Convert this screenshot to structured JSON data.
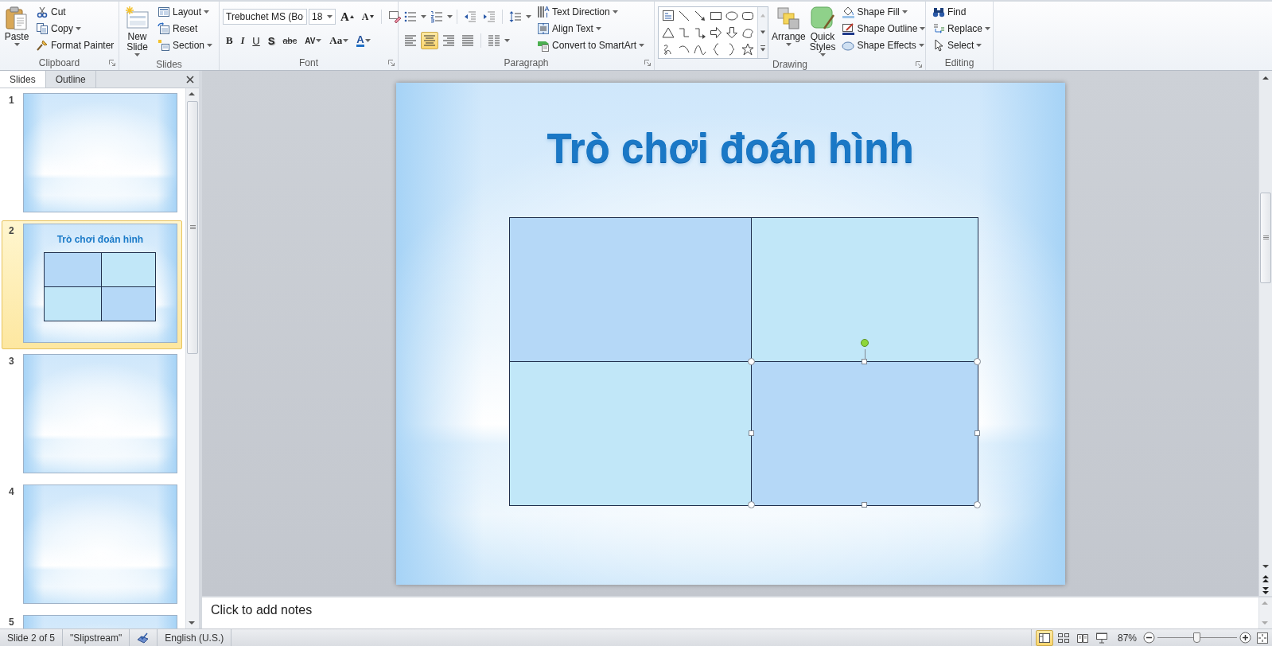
{
  "ribbon": [
    {
      "kind": "clipboard",
      "label": "Clipboard",
      "launcher": true,
      "large": [
        {
          "label": "Paste",
          "dropdown": true
        }
      ],
      "commands": [
        {
          "label": "Cut",
          "dropdown": false
        },
        {
          "label": "Copy",
          "dropdown": true
        },
        {
          "label": "Format Painter",
          "dropdown": false
        }
      ]
    },
    {
      "kind": "slides",
      "label": "Slides",
      "launcher": false,
      "large": [
        {
          "label": "New Slide",
          "dropdown": true
        }
      ],
      "commands": [
        {
          "label": "Layout",
          "dropdown": true
        },
        {
          "label": "Reset",
          "dropdown": false
        },
        {
          "label": "Section",
          "dropdown": true
        }
      ]
    },
    {
      "kind": "font",
      "label": "Font",
      "launcher": true,
      "font_name": "Trebuchet MS (Bo",
      "font_size": "18",
      "grow": "A",
      "shrink": "A",
      "formats": [
        {
          "label": "B",
          "dropdown": false
        },
        {
          "label": "I",
          "dropdown": false
        },
        {
          "label": "U",
          "dropdown": false
        },
        {
          "label": "S",
          "dropdown": false
        },
        {
          "label": "abc",
          "dropdown": false
        },
        {
          "label": "AV",
          "dropdown": true
        },
        {
          "label": "Aa",
          "dropdown": true
        },
        {
          "label": "A",
          "dropdown": true
        }
      ]
    },
    {
      "kind": "paragraph",
      "label": "Paragraph",
      "launcher": true,
      "alignments": [
        {
          "selected": false
        },
        {
          "selected": true
        },
        {
          "selected": false
        },
        {
          "selected": false
        }
      ],
      "commands": [
        {
          "label": "Text Direction",
          "dropdown": true
        },
        {
          "label": "Align Text",
          "dropdown": true
        },
        {
          "label": "Convert to SmartArt",
          "dropdown": true
        }
      ]
    },
    {
      "kind": "drawing",
      "label": "Drawing",
      "launcher": true,
      "large": [
        {
          "label": "Arrange",
          "dropdown": true
        },
        {
          "label": "Quick Styles",
          "dropdown": true
        }
      ],
      "commands": [
        {
          "label": "Shape Fill",
          "dropdown": true
        },
        {
          "label": "Shape Outline",
          "dropdown": true
        },
        {
          "label": "Shape Effects",
          "dropdown": true
        }
      ]
    },
    {
      "kind": "editing",
      "label": "Editing",
      "launcher": false,
      "commands": [
        {
          "label": "Find",
          "dropdown": false
        },
        {
          "label": "Replace",
          "dropdown": true
        },
        {
          "label": "Select",
          "dropdown": true
        }
      ]
    }
  ],
  "panel_tabs": [
    {
      "label": "Slides",
      "selected": true
    },
    {
      "label": "Outline",
      "selected": false
    }
  ],
  "thumbnails": [
    {
      "number": "1",
      "selected": false
    },
    {
      "number": "2",
      "selected": true,
      "title": "Trò chơi đoán hình",
      "shapes": [
        {
          "color": "#b5d8f7"
        },
        {
          "color": "#c1e7f8"
        },
        {
          "color": "#c1e7f8"
        },
        {
          "color": "#b5d8f7"
        }
      ]
    },
    {
      "number": "3",
      "selected": false
    },
    {
      "number": "4",
      "selected": false
    },
    {
      "number": "5",
      "selected": false
    }
  ],
  "slide": {
    "title": "Trò chơi đoán hình",
    "shapes": [
      {
        "color": "#b5d8f7",
        "selected": false
      },
      {
        "color": "#c1e7f8",
        "selected": false
      },
      {
        "color": "#c1e7f8",
        "selected": false
      },
      {
        "color": "#b5d8f7",
        "selected": true
      }
    ]
  },
  "notes": {
    "placeholder": "Click to add notes"
  },
  "status_bar": {
    "slide": "Slide 2 of 5",
    "theme": "\"Slipstream\"",
    "language": "English (U.S.)",
    "views": [
      {
        "selected": true
      },
      {
        "selected": false
      },
      {
        "selected": false
      },
      {
        "selected": false
      }
    ],
    "zoom": "87%",
    "zoom_slider": {
      "level": 0.5
    }
  }
}
